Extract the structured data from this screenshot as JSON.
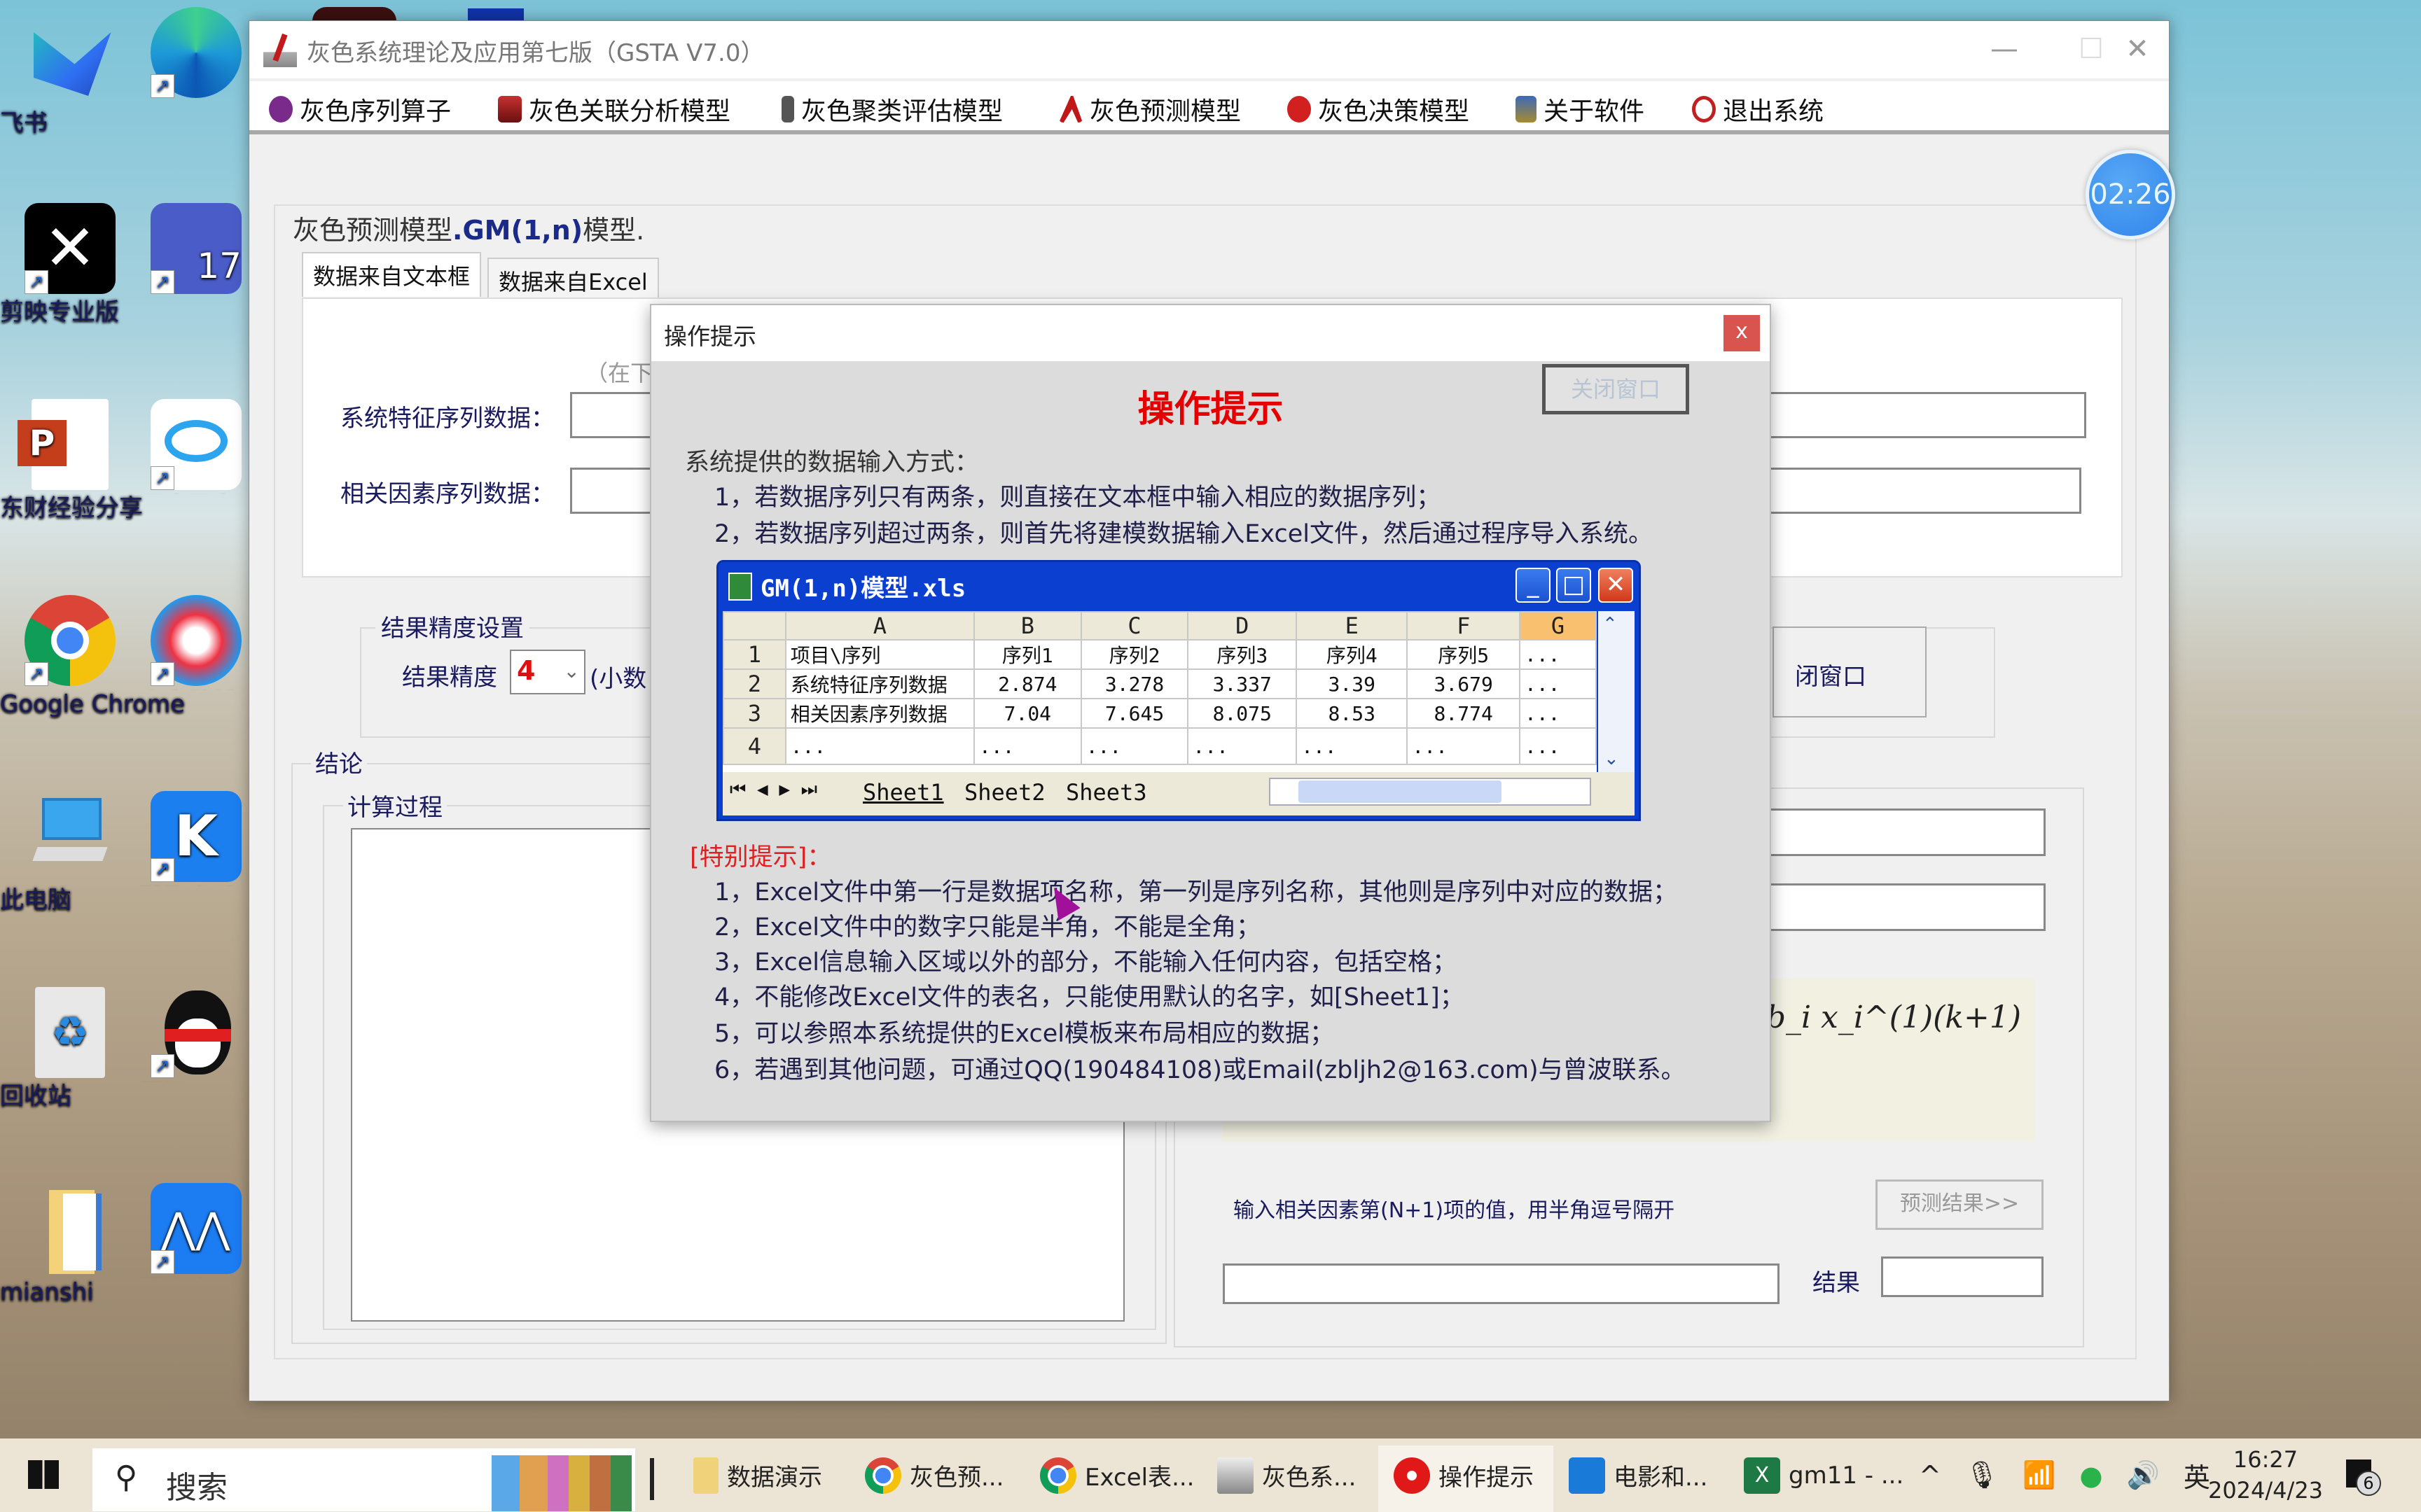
{
  "desktop": {
    "icons": [
      {
        "label": "飞书"
      },
      {
        "label": "Microsoft Edge"
      },
      {
        "label": "剪映专业版"
      },
      {
        "label": "StataMP 17 (64-bit)"
      },
      {
        "label": "东财经验分享"
      },
      {
        "label": "百度网盘"
      },
      {
        "label": "Google Chrome"
      },
      {
        "label": "小鸟壁纸"
      },
      {
        "label": "此电脑"
      },
      {
        "label": "酷狗音乐"
      },
      {
        "label": "回收站"
      },
      {
        "label": "腾讯QQ"
      },
      {
        "label": "mianshi"
      },
      {
        "label": "腾讯会议"
      }
    ]
  },
  "window": {
    "title": "灰色系统理论及应用第七版（GSTA V7.0）",
    "controls": {
      "minimize": "—",
      "maximize": "☐",
      "close": "✕"
    },
    "menu": [
      {
        "label": "灰色序列算子",
        "icon": "operator-icon",
        "color": "#7a2a8a"
      },
      {
        "label": "灰色关联分析模型",
        "icon": "relation-icon",
        "color": "#a01818"
      },
      {
        "label": "灰色聚类评估模型",
        "icon": "cluster-icon",
        "color": "#444444"
      },
      {
        "label": "灰色预测模型",
        "icon": "forecast-icon",
        "color": "#c01818"
      },
      {
        "label": "灰色决策模型",
        "icon": "decision-icon",
        "color": "#d02020"
      },
      {
        "label": "关于软件",
        "icon": "about-icon",
        "color": "#2a5aa8"
      },
      {
        "label": "退出系统",
        "icon": "exit-icon",
        "color": "#c02020"
      }
    ]
  },
  "main": {
    "heading_prefix": "灰色预测模型",
    "heading_model": ".GM(1,n)",
    "heading_suffix": "模型.",
    "tabs": [
      {
        "label": "数据来自文本框",
        "active": true
      },
      {
        "label": "数据来自Excel",
        "active": false
      }
    ],
    "hint_partial": "（在下",
    "fields": {
      "system_label": "系统特征序列数据：",
      "system_value": "",
      "factor_label": "相关因素序列数据：",
      "factor_value": ""
    },
    "precision": {
      "group_label": "结果精度设置",
      "label": "结果精度",
      "value": "4",
      "suffix_partial": "(小数"
    },
    "close_window_partial": "闭窗口",
    "conclusion": {
      "group_label": "结论",
      "process_label": "计算过程",
      "process_value": ""
    },
    "predict": {
      "input_label": "输入相关因素第(N+1)项的值，用半角逗号隔开",
      "button": "预测结果>>",
      "input_value": "",
      "result_label": "结果",
      "result_value": ""
    },
    "formula_visible": "+ (1/a) Σ_{i=2}^{N} b_i x_i^(1)(k+1)"
  },
  "timer": "02:26",
  "dialog": {
    "title": "操作提示",
    "close": "x",
    "heading": "操作提示",
    "close_window_button": "关闭窗口",
    "intro": "系统提供的数据输入方式：",
    "methods": [
      "1，若数据序列只有两条，则直接在文本框中输入相应的数据序列；",
      "2，若数据序列超过两条，则首先将建模数据输入Excel文件，然后通过程序导入系统。"
    ],
    "excel": {
      "title": "GM(1,n)模型.xls",
      "columns": [
        "A",
        "B",
        "C",
        "D",
        "E",
        "F",
        "G"
      ],
      "rows": [
        {
          "n": "1",
          "cells": [
            "项目\\序列",
            "序列1",
            "序列2",
            "序列3",
            "序列4",
            "序列5",
            "..."
          ]
        },
        {
          "n": "2",
          "cells": [
            "系统特征序列数据",
            "2.874",
            "3.278",
            "3.337",
            "3.39",
            "3.679",
            "..."
          ]
        },
        {
          "n": "3",
          "cells": [
            "相关因素序列数据",
            "7.04",
            "7.645",
            "8.075",
            "8.53",
            "8.774",
            "..."
          ]
        },
        {
          "n": "4",
          "cells": [
            "...",
            "...",
            "...",
            "...",
            "...",
            "...",
            "..."
          ]
        }
      ],
      "sheets": [
        "Sheet1",
        "Sheet2",
        "Sheet3"
      ],
      "active_sheet": "Sheet1",
      "selected_column": "G"
    },
    "special_label": "[特别提示]：",
    "notes": [
      "1，Excel文件中第一行是数据项名称，第一列是序列名称，其他则是序列中对应的数据；",
      "2，Excel文件中的数字只能是半角，不能是全角；",
      "3，Excel信息输入区域以外的部分，不能输入任何内容，包括空格；",
      "4，不能修改Excel文件的表名，只能使用默认的名字，如[Sheet1]；",
      "5，可以参照本系统提供的Excel模板来布局相应的数据；",
      "6，若遇到其他问题，可通过QQ(190484108)或Email(zbljh2@163.com)与曾波联系。"
    ]
  },
  "taskbar": {
    "search_placeholder": "搜索",
    "apps": [
      {
        "label": "数据演示",
        "icon": "folder-icon"
      },
      {
        "label": "灰色预...",
        "icon": "chrome-icon"
      },
      {
        "label": "Excel表...",
        "icon": "chrome-icon"
      },
      {
        "label": "灰色系...",
        "icon": "gsta-icon"
      },
      {
        "label": "操作提示",
        "icon": "gear-icon",
        "active": true
      },
      {
        "label": "电影和...",
        "icon": "movies-icon"
      },
      {
        "label": "gm11 - ...",
        "icon": "excel-icon"
      }
    ],
    "tray": {
      "chevron": "^",
      "ime": "英"
    },
    "time": "16:27",
    "date": "2024/4/23",
    "notifications": "6"
  }
}
